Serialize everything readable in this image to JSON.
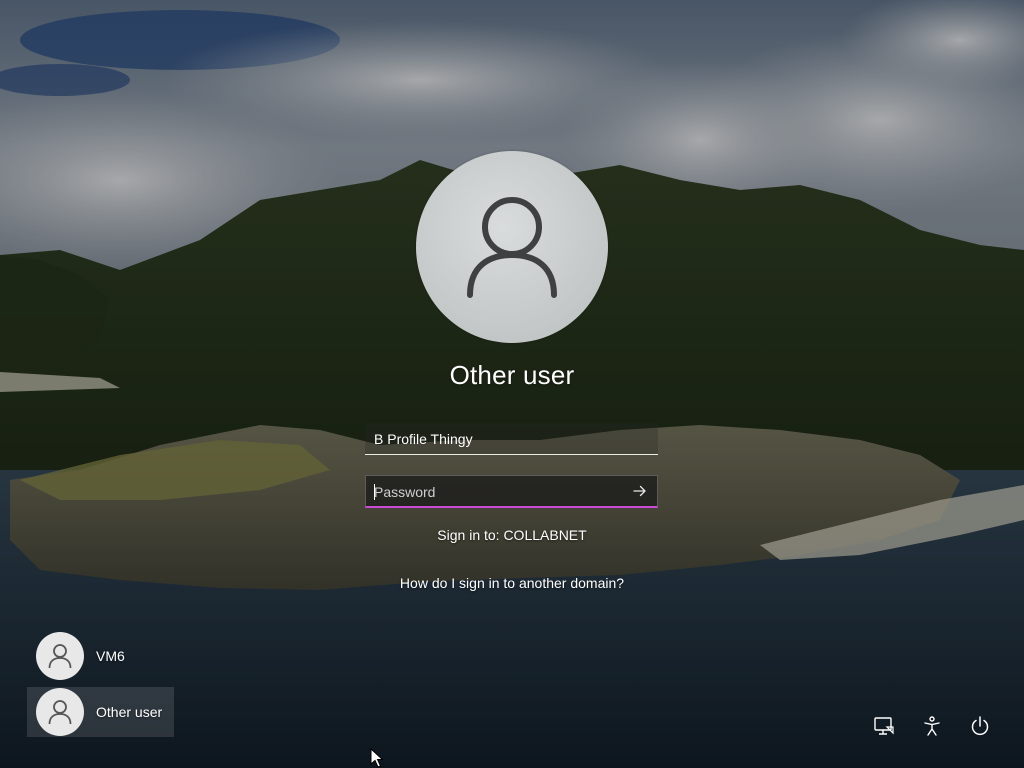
{
  "lock_screen": {
    "selected_user": "Other user",
    "username_value": "B Profile Thingy",
    "password_placeholder": "Password",
    "sign_in_to": "Sign in to: COLLABNET",
    "domain_help_link": "How do I sign in to another domain?"
  },
  "user_list": [
    {
      "label": "VM6",
      "selected": false
    },
    {
      "label": "Other user",
      "selected": true
    }
  ],
  "system_buttons": [
    {
      "icon": "network-icon"
    },
    {
      "icon": "accessibility-icon"
    },
    {
      "icon": "power-icon"
    }
  ],
  "colors": {
    "focus_underline": "#c84ad6",
    "text": "#ffffff"
  }
}
